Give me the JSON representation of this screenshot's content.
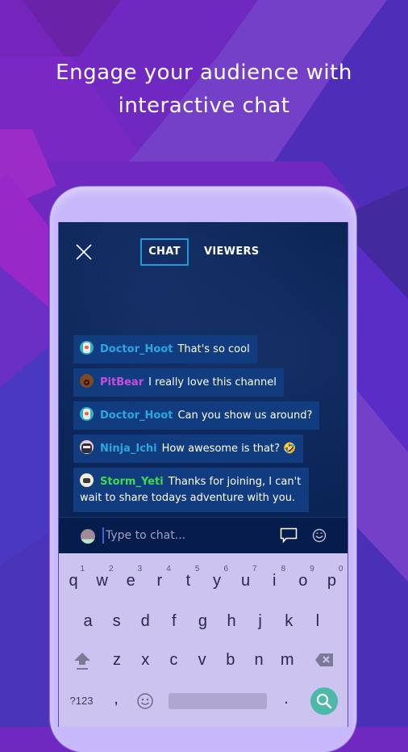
{
  "headline": {
    "line1": "Engage your audience with",
    "line2": "interactive chat"
  },
  "header": {
    "close_icon": "close-icon",
    "tabs": [
      {
        "label": "CHAT",
        "active": true
      },
      {
        "label": "VIEWERS",
        "active": false
      }
    ]
  },
  "messages": [
    {
      "user": "Doctor_Hoot",
      "text": "That's so cool",
      "user_color": "#2aa6e0",
      "avatar": "owl-avatar"
    },
    {
      "user": "PitBear",
      "text": "I really love this channel",
      "user_color": "#c64ee0",
      "avatar": "bear-avatar"
    },
    {
      "user": "Doctor_Hoot",
      "text": "Can you show us around?",
      "user_color": "#2aa6e0",
      "avatar": "owl-avatar"
    },
    {
      "user": "Ninja_Ichi",
      "text": "How awesome is that? 🤣",
      "user_color": "#2aa6e0",
      "avatar": "ninja-avatar"
    },
    {
      "user": "Storm_Yeti",
      "text": "Thanks for joining, I can't wait to share todays adventure with you.",
      "user_color": "#3ddc4a",
      "avatar": "yeti-avatar"
    }
  ],
  "input": {
    "placeholder": "Type to chat...",
    "value": ""
  },
  "keyboard": {
    "row1": [
      {
        "k": "q",
        "h": "1"
      },
      {
        "k": "w",
        "h": "2"
      },
      {
        "k": "e",
        "h": "3"
      },
      {
        "k": "r",
        "h": "4"
      },
      {
        "k": "t",
        "h": "5"
      },
      {
        "k": "y",
        "h": "6"
      },
      {
        "k": "u",
        "h": "7"
      },
      {
        "k": "i",
        "h": "8"
      },
      {
        "k": "o",
        "h": "9"
      },
      {
        "k": "p",
        "h": "0"
      }
    ],
    "row2": [
      "a",
      "s",
      "d",
      "f",
      "g",
      "h",
      "j",
      "k",
      "l"
    ],
    "row3": [
      "z",
      "x",
      "c",
      "v",
      "b",
      "n",
      "m"
    ],
    "symbols_label": "?123",
    "comma": ",",
    "period": "."
  },
  "colors": {
    "accent": "#1e9ad6",
    "screen_bg": "#0a2456",
    "bubble_bg": "#123c80",
    "phone_frame": "#c7b8fb",
    "keyboard_bg": "#cdc3f1",
    "search_key": "#4cb8a8"
  }
}
